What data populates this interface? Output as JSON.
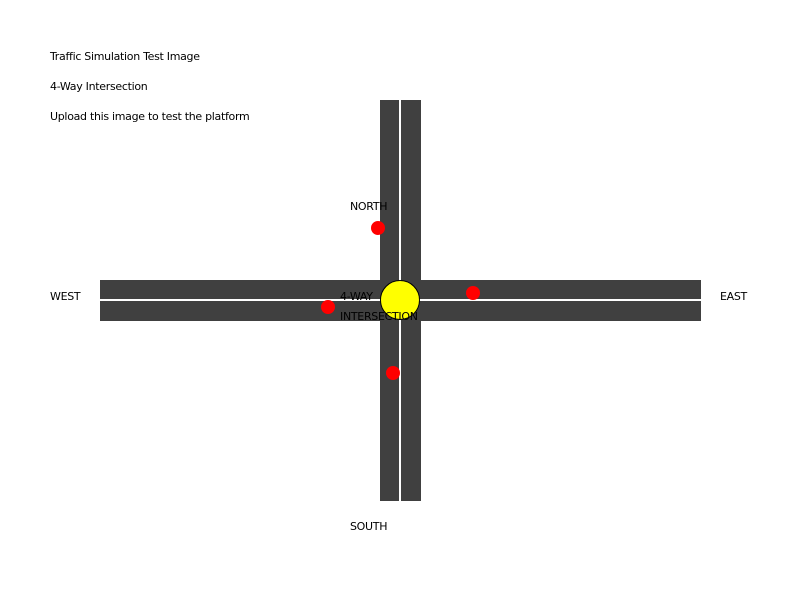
{
  "header": {
    "title": "Traffic Simulation Test Image",
    "subtitle": "4-Way Intersection",
    "instruction": "Upload this image to test the platform"
  },
  "directions": {
    "north": "NORTH",
    "south": "SOUTH",
    "east": "EAST",
    "west": "WEST"
  },
  "intersection": {
    "label_line1": "4-WAY",
    "label_line2": "INTERSECTION"
  },
  "colors": {
    "road": "#404040",
    "lane_line": "#ffffff",
    "vehicle": "#ff0000",
    "center_marker": "#ffff00",
    "background": "#ffffff"
  },
  "vehicles": [
    {
      "name": "vehicle-north"
    },
    {
      "name": "vehicle-west"
    },
    {
      "name": "vehicle-east"
    },
    {
      "name": "vehicle-south"
    }
  ]
}
